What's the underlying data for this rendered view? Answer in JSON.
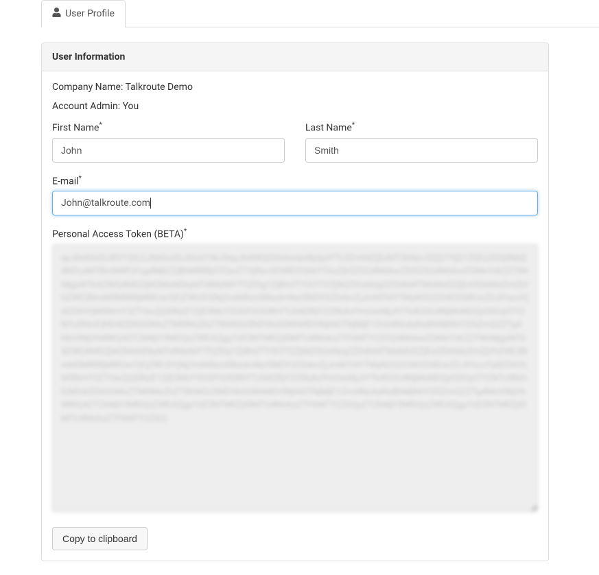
{
  "tab": {
    "label": "User Profile"
  },
  "panel": {
    "title": "User Information"
  },
  "info": {
    "company_label": "Company Name: ",
    "company_value": "Talkroute Demo",
    "admin_label": "Account Admin: ",
    "admin_value": "You"
  },
  "form": {
    "first_name_label": "First Name",
    "first_name_value": "John",
    "last_name_label": "Last Name",
    "last_name_value": "Smith",
    "email_label": "E-mail",
    "email_value": "John@talkroute.com",
    "token_label": "Personal Access Token (BETA)",
    "token_value": "eyJ0eXAiOiJKV1QiLCJhbGciOiJSUzI1NiJ9eyJhdWQiOiIxIiwianRpIjoiYTc3ZmNlZjExNTZkNzc3ZjQ1YjQ1ZGEzZGQ0MjQ4NTczMTBmNWFjYzg4MjI2ZjBhMWRjOTQwZTVjNzc5OWE3YjhkYTAxZjk5ZGQ4MzkwZDl5ZGQ4MzkwZGMxYzk2ZTNhMjgxNTk4ZWQ4MGZjM2MxNDkyNTdlMzNlYTFjZDg1ZjBhOTY3OTI2ZjNlZGUxNzg2ZDdhMTMzMzI2ZjExODlhMzZmZjVhZWE3NmM5MWRjMWUwYjFjZWU5YjNjZmNiNzU0NzdmNzI5NDY3ZDdmZjJmNThlYTMyN2Q2OWI2OWUxZDJlYzcxYjdlZDhlYjM5NmY3ZTUwZjQ0NzE1ZjE0MzY5OGFhOGRhYTJhN2RjY2I2NzkxYmUwMjJlYTk4OGU4NjMxNDQyODUyOTI2NTc0NmFjNDdlZDllOGMxZTM0MzZhZTRhNGU3NDVkOGNhMDViNjhlOTNjMjE1ZmI4NzAyNzBhMjNhY2I5ZmQ2ZTg4MzVlNjVhMWQ4ZTZkMjY5MDQzZWE4ZjgyYzE5NTM0ZjI0MTU4MzkzZTFkMTY2ZGQ4MzkwZGMxYzk2ZTNhMjgxNTk4ZWQ4MGZjM2MxNDkyNTdlMzNlYTFjZDg1ZjBhOTY3OTI2ZjNlZGUxNzg2ZDdhMTMzMzI2ZjExODlhMzZmZjVhZWE3NmM5MWRjMWUwYjFjZWU5YjNjZmNiNzU0NzdmNzI5NDY3ZDdmZjJmNThlYTMyN2Q2OWI2OWUxZDJlYzcxYjdlZDhlYjM5NmY3ZTUwZjQ0NzE1ZjE0MzY5OGFhOGRhYTJhN2RjY2I2NzkxYmUwMjJlYTk4OGU4NjMxNDQyODUyOTI2NTc0NmFjNDdlZDllOGMxZTM0MzZhZTRhNGU3NDVkOGNhMDViNjhlOTNjMjE1ZmI4NzAyNzBhMjNhY2I5ZmQ2ZTg4MzVlNjVhMWQ4ZTZkMjY5MDQzZWE4ZjgyYzE5NTM0ZjI0MTU4MzkzZTFkMTY2ZGQyZTZkMjY5MDQzZWE4ZjgyYzE5NTM0ZjI0MTU4MzkzZTFkMTY2ZGQ"
  },
  "buttons": {
    "copy_label": "Copy to clipboard"
  },
  "required_mark": "*"
}
